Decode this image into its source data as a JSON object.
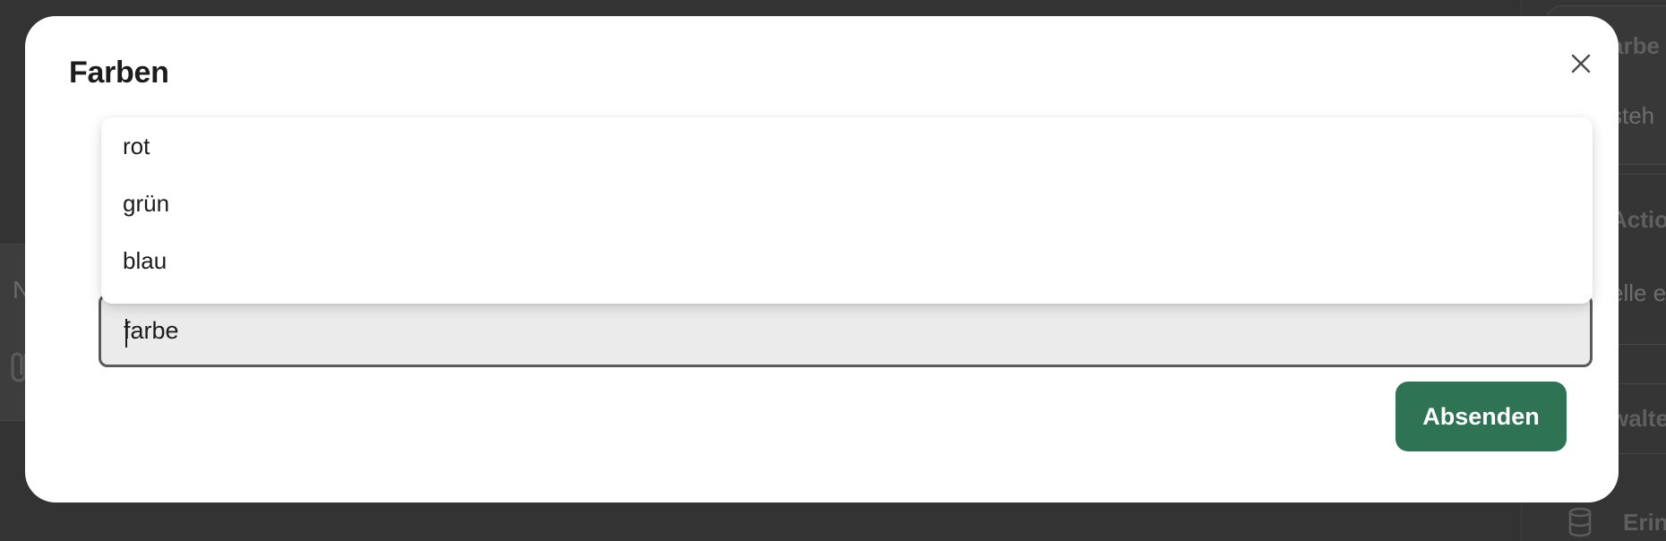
{
  "modal": {
    "title": "Farben",
    "close_icon": "close-icon",
    "input": {
      "value": "farbe"
    },
    "dropdown": {
      "options": [
        "rot",
        "grün",
        "blau"
      ]
    },
    "submit_label": "Absenden"
  },
  "background": {
    "left_card_letter": "N",
    "right_panel_texts": [
      "arbe",
      "steh",
      "Actio",
      "elle e",
      "walte",
      "Erin"
    ],
    "icons": [
      "attachment-icon",
      "database-icon"
    ]
  },
  "colors": {
    "overlay": "#333333",
    "modal_bg": "#ffffff",
    "submit_bg": "#2f7355",
    "input_bg": "#ebebeb",
    "input_border": "#5a5a5a"
  }
}
